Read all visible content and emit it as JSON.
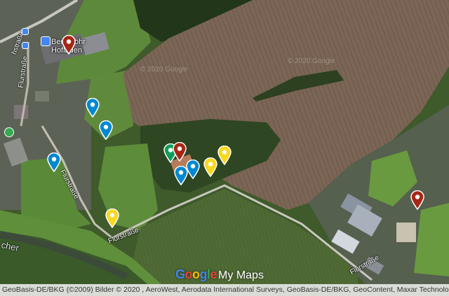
{
  "map": {
    "place_label": "Berggröhr Hofladen",
    "streets": {
      "flurstrasse_1": "Flurstraße",
      "flurstrasse_2": "Flurstraße",
      "flurstrasse_3": "Flurstraße",
      "flurstrasse_4": "Flurstraße",
      "nordstrasse": "hstraße",
      "river": "cher"
    },
    "watermarks": [
      "© 2020 Google",
      "© 2020 Google"
    ],
    "logo": {
      "google": [
        "G",
        "o",
        "o",
        "g",
        "l",
        "e"
      ],
      "google_colors": [
        "#4285F4",
        "#EA4335",
        "#FBBC05",
        "#4285F4",
        "#34A853",
        "#EA4335"
      ],
      "product": "My Maps"
    },
    "attribution": "GeoBasis-DE/BKG (©2009) Bilder © 2020 , AeroWest, Aerodata International Surveys, GeoBasis-DE/BKG, GeoContent, Maxar Technologies"
  },
  "markers": [
    {
      "name": "marker-red-hofladen",
      "color": "#a52714"
    },
    {
      "name": "marker-blue-1",
      "color": "#0288d1"
    },
    {
      "name": "marker-blue-2",
      "color": "#0288d1"
    },
    {
      "name": "marker-blue-3",
      "color": "#0288d1"
    },
    {
      "name": "marker-green",
      "color": "#0f9d58"
    },
    {
      "name": "marker-red-2",
      "color": "#a52714"
    },
    {
      "name": "marker-blue-4",
      "color": "#0288d1"
    },
    {
      "name": "marker-blue-5",
      "color": "#0288d1"
    },
    {
      "name": "marker-yellow-1",
      "color": "#f9d71c"
    },
    {
      "name": "marker-yellow-2",
      "color": "#f9d71c"
    },
    {
      "name": "marker-yellow-3",
      "color": "#f9d71c"
    },
    {
      "name": "marker-red-east",
      "color": "#a52714"
    }
  ],
  "poi_icons": [
    {
      "name": "shopping-bag-icon",
      "color": "#4285F4"
    },
    {
      "name": "bus-stop-icon",
      "color": "#4285F4"
    },
    {
      "name": "bus-stop-icon-2",
      "color": "#4285F4"
    },
    {
      "name": "park-tree-icon",
      "color": "#34A853"
    }
  ]
}
